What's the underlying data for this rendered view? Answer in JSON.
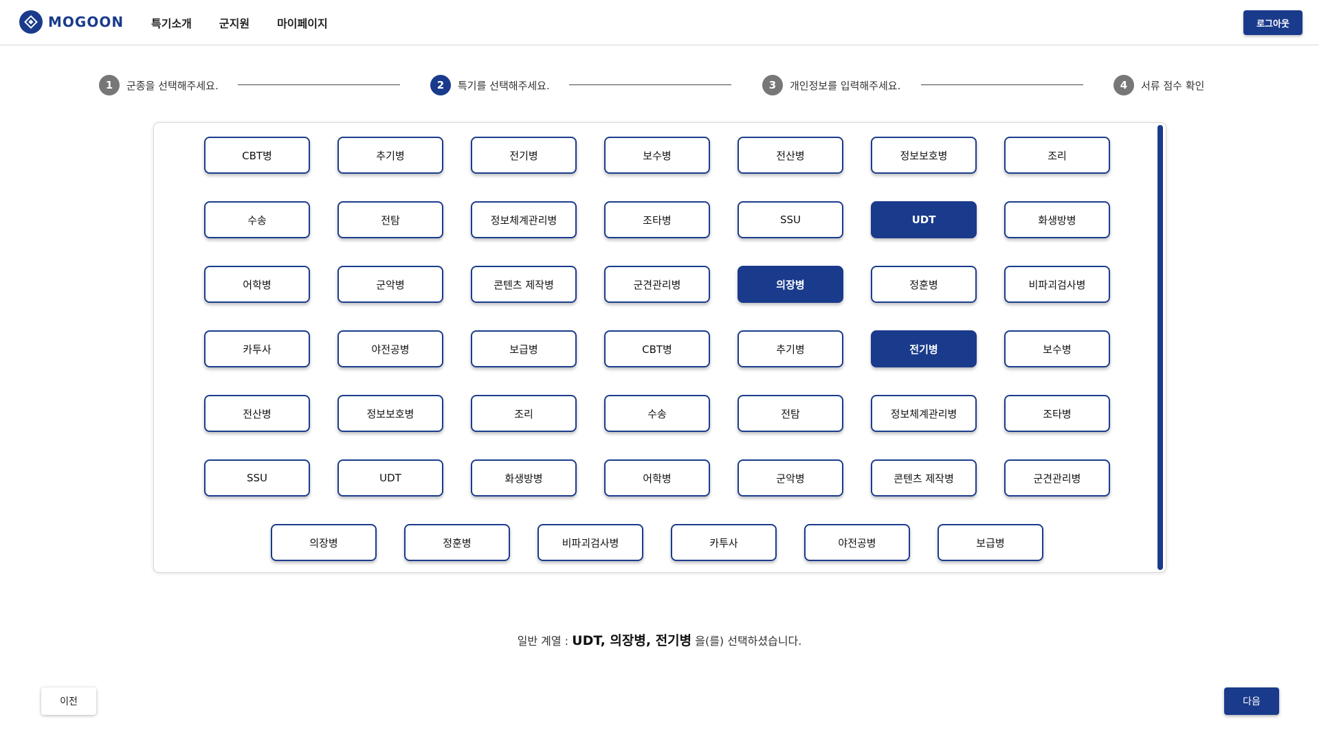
{
  "header": {
    "logo_text": "MOGOON",
    "nav": [
      "특기소개",
      "군지원",
      "마이페이지"
    ],
    "logout_label": "로그아웃"
  },
  "stepper": {
    "active_step": 2,
    "steps": [
      {
        "num": "1",
        "label": "군종을 선택해주세요."
      },
      {
        "num": "2",
        "label": "특기를 선택해주세요."
      },
      {
        "num": "3",
        "label": "개인정보를 입력해주세요."
      },
      {
        "num": "4",
        "label": "서류 점수 확인"
      }
    ]
  },
  "specialties": {
    "rows": [
      [
        "CBT병",
        "추기병",
        "전기병",
        "보수병",
        "전산병",
        "정보보호병",
        "조리"
      ],
      [
        "수송",
        "전탐",
        "정보체계관리병",
        "조타병",
        "SSU",
        "UDT",
        "화생방병"
      ],
      [
        "어학병",
        "군악병",
        "콘텐츠 제작병",
        "군견관리병",
        "의장병",
        "정훈병",
        "비파괴검사병"
      ],
      [
        "카투사",
        "야전공병",
        "보급병",
        "CBT병",
        "추기병",
        "전기병",
        "보수병"
      ],
      [
        "전산병",
        "정보보호병",
        "조리",
        "수송",
        "전탐",
        "정보체계관리병",
        "조타병"
      ],
      [
        "SSU",
        "UDT",
        "화생방병",
        "어학병",
        "군악병",
        "콘텐츠 제작병",
        "군견관리병"
      ],
      [
        "의장병",
        "정훈병",
        "비파괴검사병",
        "카투사",
        "야전공병",
        "보급병"
      ]
    ],
    "selected_cells": [
      [
        1,
        5
      ],
      [
        2,
        4
      ],
      [
        3,
        5
      ]
    ]
  },
  "summary": {
    "prefix": "일반 계열 : ",
    "picked": "UDT, 의장병, 전기병",
    "suffix": " 을(를) 선택하셨습니다."
  },
  "buttons": {
    "prev": "이전",
    "next": "다음"
  },
  "colors": {
    "accent": "#1a3b8c",
    "inactive_step": "#777777"
  }
}
